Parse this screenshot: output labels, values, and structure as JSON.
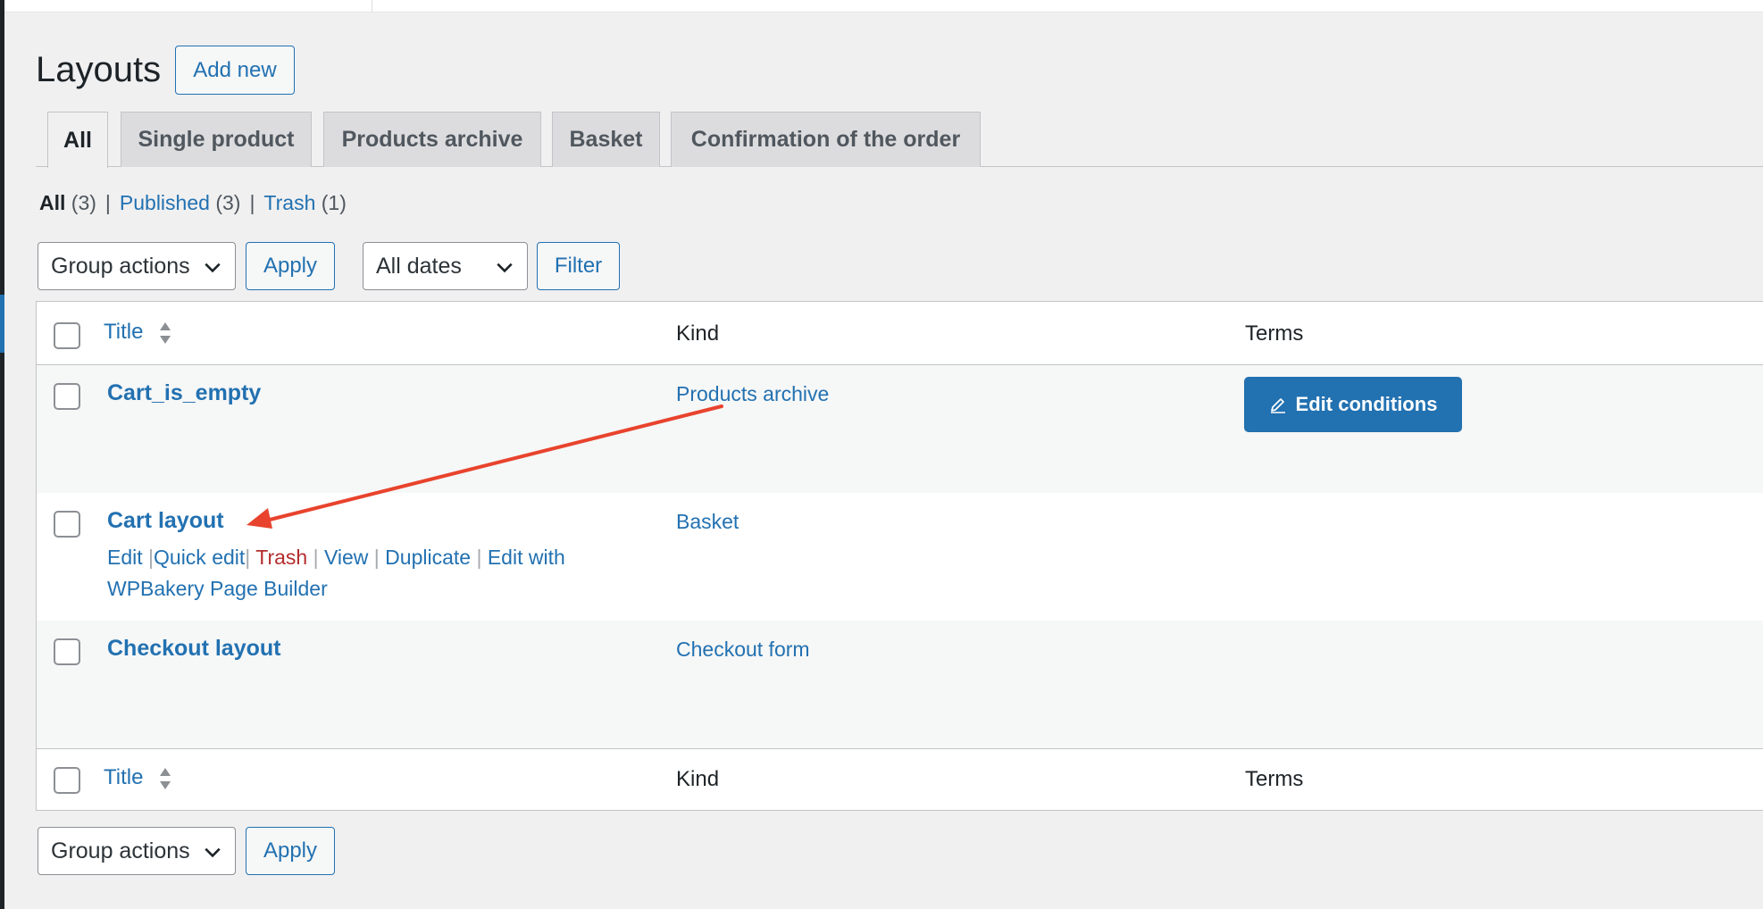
{
  "page": {
    "title": "Layouts",
    "add_new_label": "Add new"
  },
  "tabs": [
    {
      "label": "All",
      "active": true
    },
    {
      "label": "Single product",
      "active": false
    },
    {
      "label": "Products archive",
      "active": false
    },
    {
      "label": "Basket",
      "active": false
    },
    {
      "label": "Confirmation of the order",
      "active": false
    }
  ],
  "views": {
    "all_label": "All",
    "all_count": "(3)",
    "published_label": "Published",
    "published_count": "(3)",
    "trash_label": "Trash",
    "trash_count": "(1)",
    "separator": "|"
  },
  "toolbar_top": {
    "bulk_select": "Group actions",
    "apply_label": "Apply",
    "dates_select": "All dates",
    "filter_label": "Filter"
  },
  "toolbar_bottom": {
    "bulk_select": "Group actions",
    "apply_label": "Apply"
  },
  "table": {
    "columns": {
      "title": "Title",
      "kind": "Kind",
      "terms": "Terms"
    },
    "rows": [
      {
        "title": "Cart_is_empty",
        "kind": "Products archive",
        "terms_button": "Edit conditions"
      },
      {
        "title": "Cart layout",
        "kind": "Basket",
        "actions": {
          "edit": "Edit",
          "quick_edit": "Quick edit",
          "trash": "Trash",
          "view": "View",
          "duplicate": "Duplicate",
          "edit_with": "Edit with WPBakery Page Builder"
        }
      },
      {
        "title": "Checkout layout",
        "kind": "Checkout form"
      }
    ]
  },
  "colors": {
    "link": "#2271b1",
    "primary_button": "#2271b1",
    "trash": "#b32d2e",
    "annotation_arrow": "#e8432d",
    "background": "#f0f0f1"
  },
  "icons": {
    "sort": "sort-arrows-icon",
    "edit_conditions": "pencil-icon",
    "select_chevron": "chevron-down-icon"
  }
}
